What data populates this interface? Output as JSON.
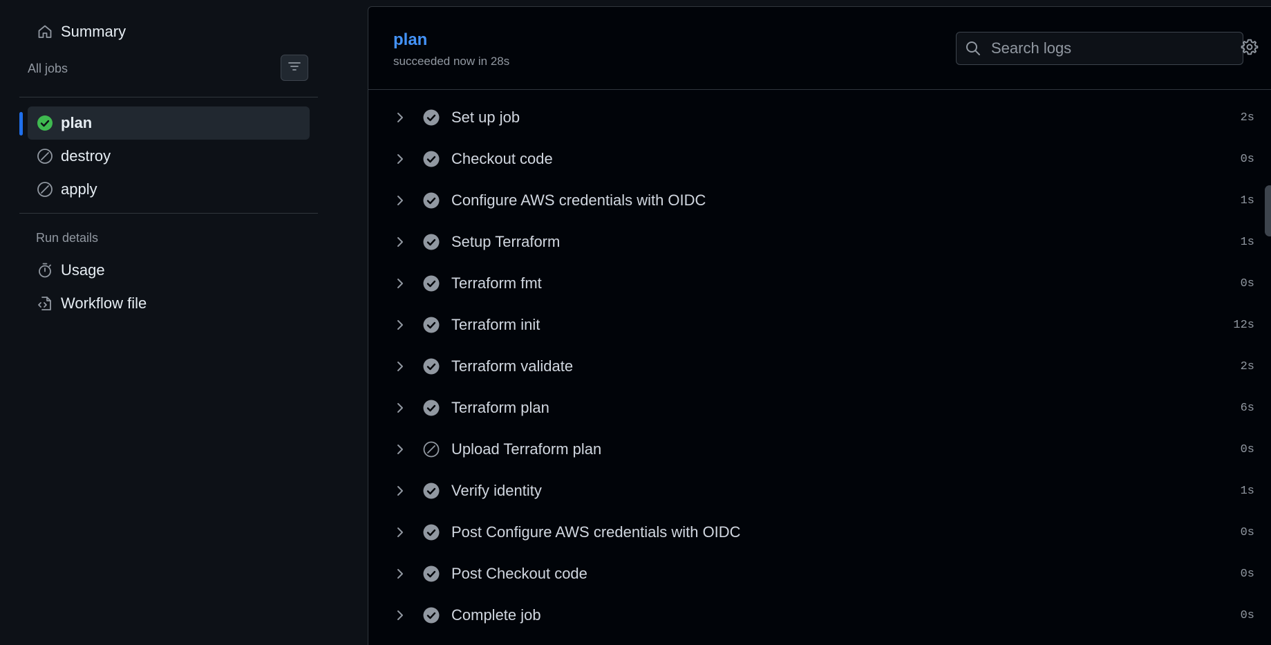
{
  "sidebar": {
    "summary_label": "Summary",
    "all_jobs_label": "All jobs",
    "jobs": [
      {
        "label": "plan",
        "status": "success"
      },
      {
        "label": "destroy",
        "status": "skipped"
      },
      {
        "label": "apply",
        "status": "skipped"
      }
    ],
    "run_details_label": "Run details",
    "usage_label": "Usage",
    "workflow_file_label": "Workflow file"
  },
  "job": {
    "title": "plan",
    "status_text": "succeeded now in 28s"
  },
  "search": {
    "placeholder": "Search logs"
  },
  "steps": [
    {
      "name": "Set up job",
      "duration": "2s",
      "status": "success"
    },
    {
      "name": "Checkout code",
      "duration": "0s",
      "status": "success"
    },
    {
      "name": "Configure AWS credentials with OIDC",
      "duration": "1s",
      "status": "success"
    },
    {
      "name": "Setup Terraform",
      "duration": "1s",
      "status": "success"
    },
    {
      "name": "Terraform fmt",
      "duration": "0s",
      "status": "success"
    },
    {
      "name": "Terraform init",
      "duration": "12s",
      "status": "success"
    },
    {
      "name": "Terraform validate",
      "duration": "2s",
      "status": "success"
    },
    {
      "name": "Terraform plan",
      "duration": "6s",
      "status": "success"
    },
    {
      "name": "Upload Terraform plan",
      "duration": "0s",
      "status": "skipped"
    },
    {
      "name": "Verify identity",
      "duration": "1s",
      "status": "success"
    },
    {
      "name": "Post Configure AWS credentials with OIDC",
      "duration": "0s",
      "status": "success"
    },
    {
      "name": "Post Checkout code",
      "duration": "0s",
      "status": "success"
    },
    {
      "name": "Complete job",
      "duration": "0s",
      "status": "success"
    }
  ],
  "colors": {
    "background": "#0d1117",
    "panel": "#010409",
    "accent_blue": "#4493f8",
    "success_green": "#3fb950",
    "muted": "#9198a1"
  }
}
